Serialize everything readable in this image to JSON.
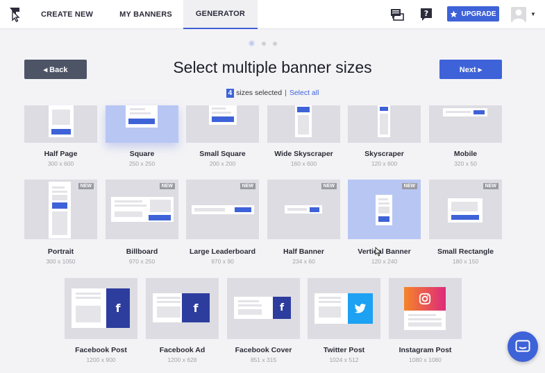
{
  "nav": {
    "tabs": [
      {
        "label": "CREATE NEW"
      },
      {
        "label": "MY BANNERS"
      },
      {
        "label": "GENERATOR"
      }
    ],
    "upgrade_label": "UPGRADE",
    "icons": [
      "logo-icon",
      "chat-icon",
      "help-icon",
      "star-icon",
      "avatar-icon",
      "caret-down-icon"
    ]
  },
  "steps": {
    "total": 3,
    "active": 1
  },
  "header": {
    "back_label": "◂ Back",
    "next_label": "Next ▸",
    "title": "Select multiple banner sizes"
  },
  "selection": {
    "count": "4",
    "text": "sizes selected",
    "separator": "|",
    "select_all": "Select all"
  },
  "rows": [
    [
      {
        "name": "Half Page",
        "dims": "300 x 600",
        "selected": false,
        "new": false
      },
      {
        "name": "Square",
        "dims": "250 x 250",
        "selected": true,
        "new": false
      },
      {
        "name": "Small Square",
        "dims": "200 x 200",
        "selected": false,
        "new": false
      },
      {
        "name": "Wide Skyscraper",
        "dims": "160 x 600",
        "selected": false,
        "new": false
      },
      {
        "name": "Skyscraper",
        "dims": "120 x 600",
        "selected": false,
        "new": false
      },
      {
        "name": "Mobile",
        "dims": "320 x 50",
        "selected": false,
        "new": false
      }
    ],
    [
      {
        "name": "Portrait",
        "dims": "300 x 1050",
        "selected": false,
        "new": true,
        "new_label": "NEW"
      },
      {
        "name": "Billboard",
        "dims": "970 x 250",
        "selected": false,
        "new": true,
        "new_label": "NEW"
      },
      {
        "name": "Large Leaderboard",
        "dims": "970 x 90",
        "selected": false,
        "new": true,
        "new_label": "NEW"
      },
      {
        "name": "Half Banner",
        "dims": "234 x 60",
        "selected": false,
        "new": true,
        "new_label": "NEW"
      },
      {
        "name": "Vertical Banner",
        "dims": "120 x 240",
        "selected": true,
        "new": true,
        "new_label": "NEW"
      },
      {
        "name": "Small Rectangle",
        "dims": "180 x 150",
        "selected": false,
        "new": true,
        "new_label": "NEW"
      }
    ],
    [
      {
        "name": "Facebook Post",
        "dims": "1200 x 900",
        "selected": false,
        "new": false
      },
      {
        "name": "Facebook Ad",
        "dims": "1200 x 628",
        "selected": false,
        "new": false
      },
      {
        "name": "Facebook Cover",
        "dims": "851 x 315",
        "selected": false,
        "new": false
      },
      {
        "name": "Twitter Post",
        "dims": "1024 x 512",
        "selected": false,
        "new": false
      },
      {
        "name": "Instagram Post",
        "dims": "1080 x 1080",
        "selected": false,
        "new": false
      }
    ]
  ],
  "colors": {
    "accent": "#3e62d8",
    "selected_tile": "#b8c6f3",
    "tile": "#dcdce2",
    "back_button": "#4c5466",
    "facebook": "#2d3d9e",
    "twitter": "#1da1f2"
  }
}
